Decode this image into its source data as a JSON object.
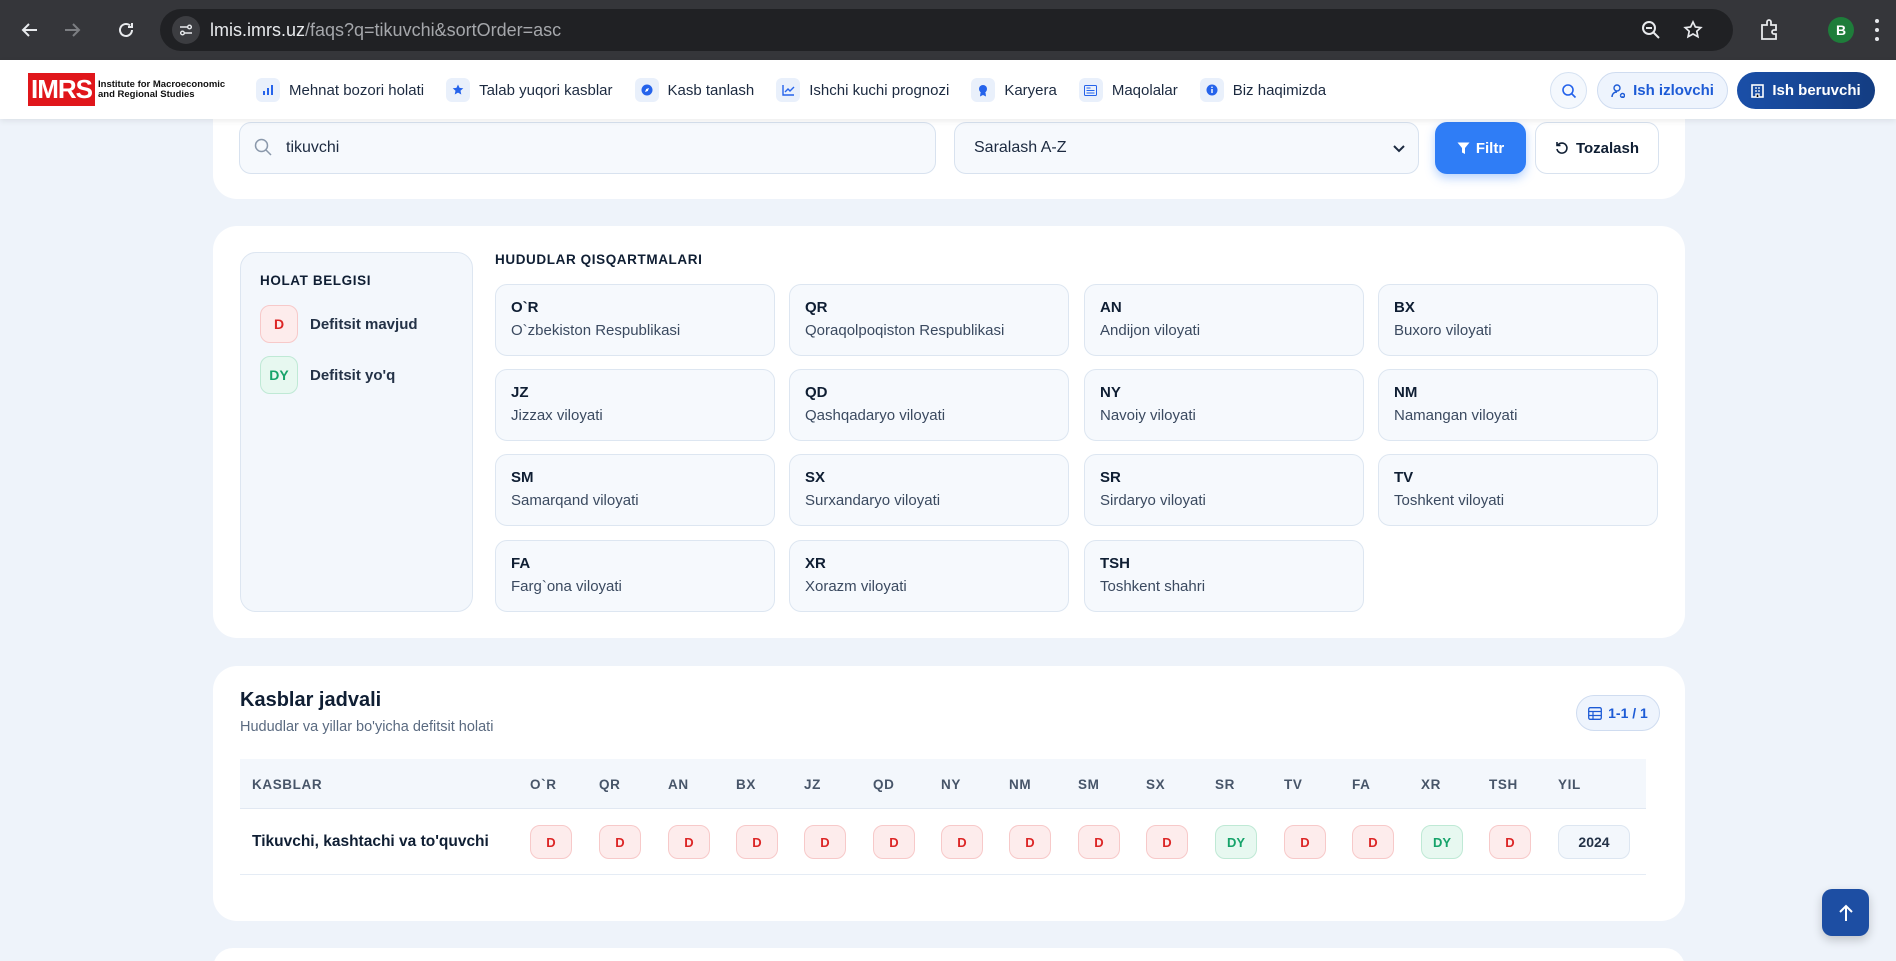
{
  "browser": {
    "url_host": "lmis.imrs.uz",
    "url_path": "/faqs?q=tikuvchi&sortOrder=asc",
    "profile_initial": "B"
  },
  "header": {
    "logo_mark": "IMRS",
    "logo_text": "Institute for Macroeconomic and Regional Studies",
    "nav": [
      {
        "label": "Mehnat bozori holati",
        "icon": "bar-chart-icon"
      },
      {
        "label": "Talab yuqori kasblar",
        "icon": "star-icon"
      },
      {
        "label": "Kasb tanlash",
        "icon": "compass-icon"
      },
      {
        "label": "Ishchi kuchi prognozi",
        "icon": "trend-line-icon"
      },
      {
        "label": "Karyera",
        "icon": "award-icon"
      },
      {
        "label": "Maqolalar",
        "icon": "newspaper-icon"
      },
      {
        "label": "Biz haqimizda",
        "icon": "info-icon"
      }
    ],
    "seeker_label": "Ish izlovchi",
    "employer_label": "Ish beruvchi"
  },
  "search": {
    "query": "tikuvchi",
    "sort_value": "Saralash A-Z",
    "filter_label": "Filtr",
    "reset_label": "Tozalash"
  },
  "legend": {
    "title": "HOLAT BELGISI",
    "items": [
      {
        "code": "D",
        "label": "Defitsit mavjud"
      },
      {
        "code": "DY",
        "label": "Defitsit yo'q"
      }
    ]
  },
  "regions": {
    "title": "HUDUDLAR QISQARTMALARI",
    "items": [
      {
        "code": "O`R",
        "name": "O`zbekiston Respublikasi"
      },
      {
        "code": "QR",
        "name": "Qoraqolpoqiston Respublikasi"
      },
      {
        "code": "AN",
        "name": "Andijon viloyati"
      },
      {
        "code": "BX",
        "name": "Buxoro viloyati"
      },
      {
        "code": "JZ",
        "name": "Jizzax viloyati"
      },
      {
        "code": "QD",
        "name": "Qashqadaryo viloyati"
      },
      {
        "code": "NY",
        "name": "Navoiy viloyati"
      },
      {
        "code": "NM",
        "name": "Namangan viloyati"
      },
      {
        "code": "SM",
        "name": "Samarqand viloyati"
      },
      {
        "code": "SX",
        "name": "Surxandaryo viloyati"
      },
      {
        "code": "SR",
        "name": "Sirdaryo viloyati"
      },
      {
        "code": "TV",
        "name": "Toshkent viloyati"
      },
      {
        "code": "FA",
        "name": "Farg`ona viloyati"
      },
      {
        "code": "XR",
        "name": "Xorazm viloyati"
      },
      {
        "code": "TSH",
        "name": "Toshkent shahri"
      }
    ]
  },
  "table": {
    "title": "Kasblar jadvali",
    "subtitle": "Hududlar va yillar bo'yicha defitsit holati",
    "pager": "1-1 / 1",
    "columns": [
      "KASBLAR",
      "O`R",
      "QR",
      "AN",
      "BX",
      "JZ",
      "QD",
      "NY",
      "NM",
      "SM",
      "SX",
      "SR",
      "TV",
      "FA",
      "XR",
      "TSH",
      "YIL"
    ],
    "rows": [
      {
        "name": "Tikuvchi, kashtachi va to'quvchi",
        "statuses": [
          "D",
          "D",
          "D",
          "D",
          "D",
          "D",
          "D",
          "D",
          "D",
          "D",
          "DY",
          "D",
          "D",
          "DY",
          "D"
        ],
        "year": "2024"
      }
    ]
  },
  "colors": {
    "primary": "#2f7df6",
    "deficit": "#dc2626",
    "no_deficit": "#16a36a",
    "employer_button": "#1a4fa8"
  }
}
